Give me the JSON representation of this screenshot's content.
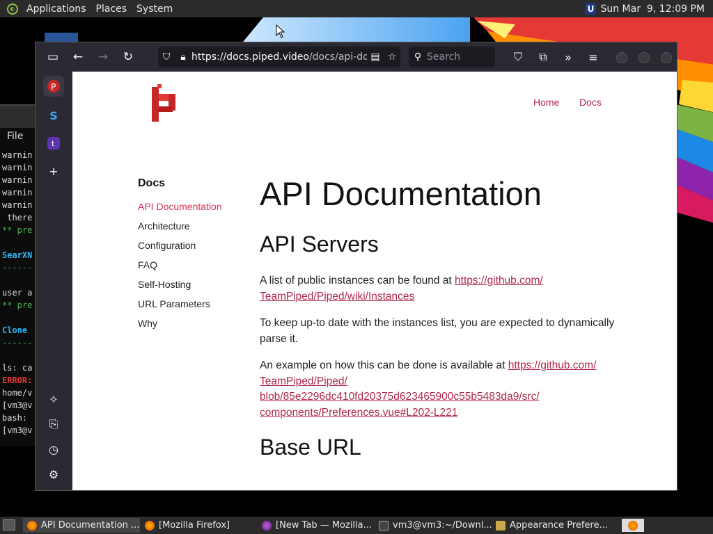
{
  "topbar": {
    "menus": [
      "Applications",
      "Places",
      "System"
    ],
    "clock": "Sun Mar  9, 12:09 PM"
  },
  "terminal": {
    "menu_file": "File",
    "lines": [
      "warnin",
      "warnin",
      "warnin",
      "warnin",
      "warnin",
      " there",
      "** pre",
      "",
      "SearXN",
      "------",
      "",
      "user a",
      "** pre",
      "",
      "Clone ",
      "------",
      "",
      "ls: ca",
      "ERROR:",
      "home/v",
      "[vm3@v",
      "bash: ",
      "[vm3@v"
    ]
  },
  "browser": {
    "url_host": "https://docs.piped.video",
    "url_path": "/docs/api-do",
    "search_placeholder": "Search"
  },
  "site": {
    "nav": [
      "Home",
      "Docs"
    ],
    "sidebar_heading": "Docs",
    "sidebar_items": [
      "API Documentation",
      "Architecture",
      "Configuration",
      "FAQ",
      "Self-Hosting",
      "URL Parameters",
      "Why"
    ],
    "title": "API Documentation",
    "section1_heading": "API Servers",
    "p1_text": "A list of public instances can be found at ",
    "p1_link": "https://github.com/TeamPiped/Piped/wiki/Instances",
    "p1_link_line1": "https://github.com/",
    "p1_link_line2": "TeamPiped/Piped/wiki/Instances",
    "p2_text": "To keep up-to date with the instances list, you are expected to dynamically parse it.",
    "p3_text": "An example on how this can be done is available at ",
    "p3_link_line1": "https://github.com/",
    "p3_link_line2": "TeamPiped/Piped/",
    "p3_link_line3": "blob/85e2296dc410fd20375d623465900c55b5483da9/src/",
    "p3_link_line4": "components/Preferences.vue#L202-L221",
    "section2_heading": "Base URL"
  },
  "taskbar": {
    "tasks": [
      "API Documentation ...",
      "[Mozilla Firefox]",
      "[New Tab — Mozilla...",
      "vm3@vm3:~/Downl...",
      "Appearance Prefere..."
    ]
  },
  "colors": {
    "accent": "#b0284a",
    "active_sidebar": "#d4345a",
    "toolbar_bg": "#2b2a33"
  }
}
